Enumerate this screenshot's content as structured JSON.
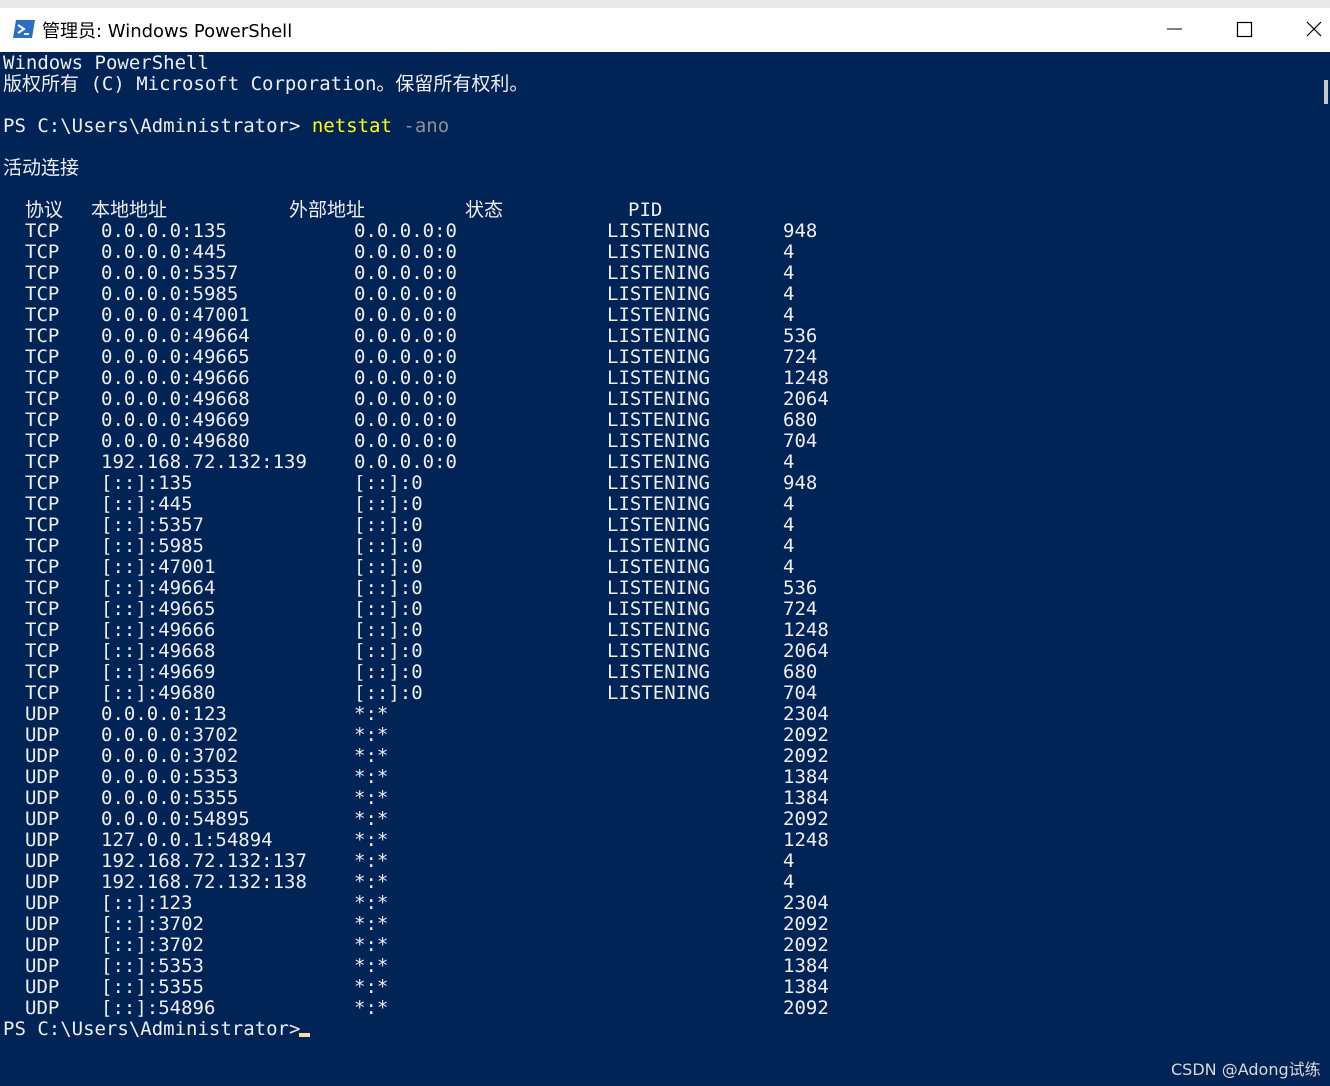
{
  "window": {
    "title": "管理员: Windows PowerShell",
    "colors": {
      "background": "#012456",
      "text": "#eeedf0",
      "command": "#ffff00",
      "parameter": "#8a8f98"
    }
  },
  "console": {
    "banner_line1": "Windows PowerShell",
    "banner_line2": "版权所有 (C) Microsoft Corporation。保留所有权利。",
    "prompt": "PS C:\\Users\\Administrator> ",
    "command": "netstat",
    "command_args": " -ano",
    "section_title": "活动连接",
    "headers": {
      "proto": "协议",
      "local": "本地地址",
      "foreign": "外部地址",
      "state": "状态",
      "pid": "PID"
    },
    "rows": [
      [
        "TCP",
        "0.0.0.0:135",
        "0.0.0.0:0",
        "LISTENING",
        "948"
      ],
      [
        "TCP",
        "0.0.0.0:445",
        "0.0.0.0:0",
        "LISTENING",
        "4"
      ],
      [
        "TCP",
        "0.0.0.0:5357",
        "0.0.0.0:0",
        "LISTENING",
        "4"
      ],
      [
        "TCP",
        "0.0.0.0:5985",
        "0.0.0.0:0",
        "LISTENING",
        "4"
      ],
      [
        "TCP",
        "0.0.0.0:47001",
        "0.0.0.0:0",
        "LISTENING",
        "4"
      ],
      [
        "TCP",
        "0.0.0.0:49664",
        "0.0.0.0:0",
        "LISTENING",
        "536"
      ],
      [
        "TCP",
        "0.0.0.0:49665",
        "0.0.0.0:0",
        "LISTENING",
        "724"
      ],
      [
        "TCP",
        "0.0.0.0:49666",
        "0.0.0.0:0",
        "LISTENING",
        "1248"
      ],
      [
        "TCP",
        "0.0.0.0:49668",
        "0.0.0.0:0",
        "LISTENING",
        "2064"
      ],
      [
        "TCP",
        "0.0.0.0:49669",
        "0.0.0.0:0",
        "LISTENING",
        "680"
      ],
      [
        "TCP",
        "0.0.0.0:49680",
        "0.0.0.0:0",
        "LISTENING",
        "704"
      ],
      [
        "TCP",
        "192.168.72.132:139",
        "0.0.0.0:0",
        "LISTENING",
        "4"
      ],
      [
        "TCP",
        "[::]:135",
        "[::]:0",
        "LISTENING",
        "948"
      ],
      [
        "TCP",
        "[::]:445",
        "[::]:0",
        "LISTENING",
        "4"
      ],
      [
        "TCP",
        "[::]:5357",
        "[::]:0",
        "LISTENING",
        "4"
      ],
      [
        "TCP",
        "[::]:5985",
        "[::]:0",
        "LISTENING",
        "4"
      ],
      [
        "TCP",
        "[::]:47001",
        "[::]:0",
        "LISTENING",
        "4"
      ],
      [
        "TCP",
        "[::]:49664",
        "[::]:0",
        "LISTENING",
        "536"
      ],
      [
        "TCP",
        "[::]:49665",
        "[::]:0",
        "LISTENING",
        "724"
      ],
      [
        "TCP",
        "[::]:49666",
        "[::]:0",
        "LISTENING",
        "1248"
      ],
      [
        "TCP",
        "[::]:49668",
        "[::]:0",
        "LISTENING",
        "2064"
      ],
      [
        "TCP",
        "[::]:49669",
        "[::]:0",
        "LISTENING",
        "680"
      ],
      [
        "TCP",
        "[::]:49680",
        "[::]:0",
        "LISTENING",
        "704"
      ],
      [
        "UDP",
        "0.0.0.0:123",
        "*:*",
        "",
        "2304"
      ],
      [
        "UDP",
        "0.0.0.0:3702",
        "*:*",
        "",
        "2092"
      ],
      [
        "UDP",
        "0.0.0.0:3702",
        "*:*",
        "",
        "2092"
      ],
      [
        "UDP",
        "0.0.0.0:5353",
        "*:*",
        "",
        "1384"
      ],
      [
        "UDP",
        "0.0.0.0:5355",
        "*:*",
        "",
        "1384"
      ],
      [
        "UDP",
        "0.0.0.0:54895",
        "*:*",
        "",
        "2092"
      ],
      [
        "UDP",
        "127.0.0.1:54894",
        "*:*",
        "",
        "1248"
      ],
      [
        "UDP",
        "192.168.72.132:137",
        "*:*",
        "",
        "4"
      ],
      [
        "UDP",
        "192.168.72.132:138",
        "*:*",
        "",
        "4"
      ],
      [
        "UDP",
        "[::]:123",
        "*:*",
        "",
        "2304"
      ],
      [
        "UDP",
        "[::]:3702",
        "*:*",
        "",
        "2092"
      ],
      [
        "UDP",
        "[::]:3702",
        "*:*",
        "",
        "2092"
      ],
      [
        "UDP",
        "[::]:5353",
        "*:*",
        "",
        "1384"
      ],
      [
        "UDP",
        "[::]:5355",
        "*:*",
        "",
        "1384"
      ],
      [
        "UDP",
        "[::]:54896",
        "*:*",
        "",
        "2092"
      ]
    ],
    "final_prompt": "PS C:\\Users\\Administrator> "
  },
  "watermark": "CSDN @Adong试练"
}
